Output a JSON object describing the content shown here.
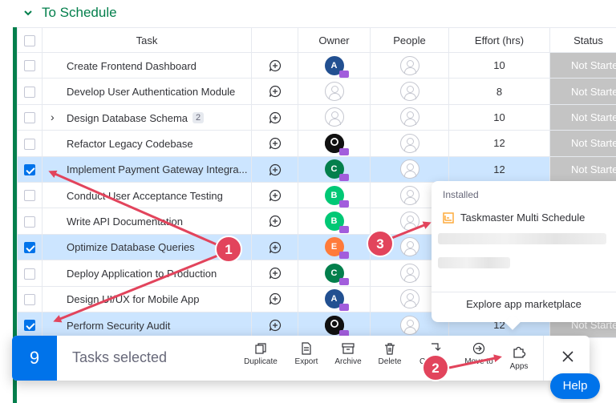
{
  "group": {
    "title": "To Schedule"
  },
  "columns": {
    "task": "Task",
    "owner": "Owner",
    "people": "People",
    "effort": "Effort (hrs)",
    "status": "Status"
  },
  "rows": [
    {
      "task": "Create Frontend Dashboard",
      "owner": {
        "type": "initial",
        "initial": "A",
        "color": "#225091"
      },
      "effort": "10",
      "status": "Not Started",
      "selected": false
    },
    {
      "task": "Develop User Authentication Module",
      "owner": {
        "type": "empty"
      },
      "effort": "8",
      "status": "Not Started",
      "selected": false
    },
    {
      "task": "Design Database Schema",
      "subitems": "2",
      "owner": {
        "type": "empty"
      },
      "effort": "10",
      "status": "Not Started",
      "selected": false
    },
    {
      "task": "Refactor Legacy Codebase",
      "owner": {
        "type": "photo"
      },
      "effort": "12",
      "status": "Not Started",
      "selected": false
    },
    {
      "task": "Implement Payment Gateway Integra...",
      "owner": {
        "type": "initial",
        "initial": "C",
        "color": "#037f4c"
      },
      "effort": "12",
      "status": "Not Started",
      "selected": true
    },
    {
      "task": "Conduct User Acceptance Testing",
      "owner": {
        "type": "initial",
        "initial": "B",
        "color": "#00c875"
      },
      "effort": "",
      "status": "",
      "selected": false
    },
    {
      "task": "Write API Documentation",
      "owner": {
        "type": "initial",
        "initial": "B",
        "color": "#00c875"
      },
      "effort": "",
      "status": "",
      "selected": false
    },
    {
      "task": "Optimize Database Queries",
      "owner": {
        "type": "initial",
        "initial": "E",
        "color": "#ff7b3a"
      },
      "effort": "",
      "status": "",
      "selected": true
    },
    {
      "task": "Deploy Application to Production",
      "owner": {
        "type": "initial",
        "initial": "C",
        "color": "#037f4c"
      },
      "effort": "",
      "status": "",
      "selected": false
    },
    {
      "task": "Design UI/UX for Mobile App",
      "owner": {
        "type": "initial",
        "initial": "A",
        "color": "#225091"
      },
      "effort": "",
      "status": "",
      "selected": false
    },
    {
      "task": "Perform Security Audit",
      "owner": {
        "type": "photo"
      },
      "effort": "12",
      "status": "Not Started",
      "selected": true
    }
  ],
  "apps_popover": {
    "title": "Installed",
    "app_name": "Taskmaster Multi Schedule",
    "footer": "Explore app marketplace"
  },
  "action_bar": {
    "count": "9",
    "label": "Tasks selected",
    "actions": {
      "duplicate": "Duplicate",
      "export": "Export",
      "archive": "Archive",
      "delete": "Delete",
      "convert": "C",
      "move_to": "Move to",
      "apps": "Apps"
    }
  },
  "help": {
    "label": "Help"
  },
  "markers": {
    "m1": "1",
    "m2": "2",
    "m3": "3"
  },
  "colors": {
    "accent": "#0073ea",
    "group": "#037f4c",
    "status_not_started": "#c4c4c4",
    "selected_row": "#cce5ff",
    "annotation": "#e2445c"
  }
}
